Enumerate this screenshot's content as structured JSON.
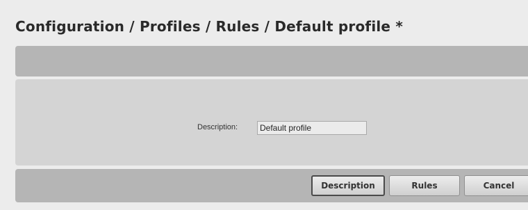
{
  "page": {
    "title": "Configuration / Profiles / Rules / Default profile *"
  },
  "form": {
    "description_label": "Description:",
    "description_value": "Default profile"
  },
  "footer": {
    "buttons": [
      {
        "label": "Description",
        "active": true
      },
      {
        "label": "Rules",
        "active": false
      },
      {
        "label": "Cancel",
        "active": false
      }
    ]
  },
  "colors": {
    "background": "#ececec",
    "bar": "#b5b5b5",
    "panel": "#d4d4d4",
    "title_text": "#2a2a2a"
  }
}
